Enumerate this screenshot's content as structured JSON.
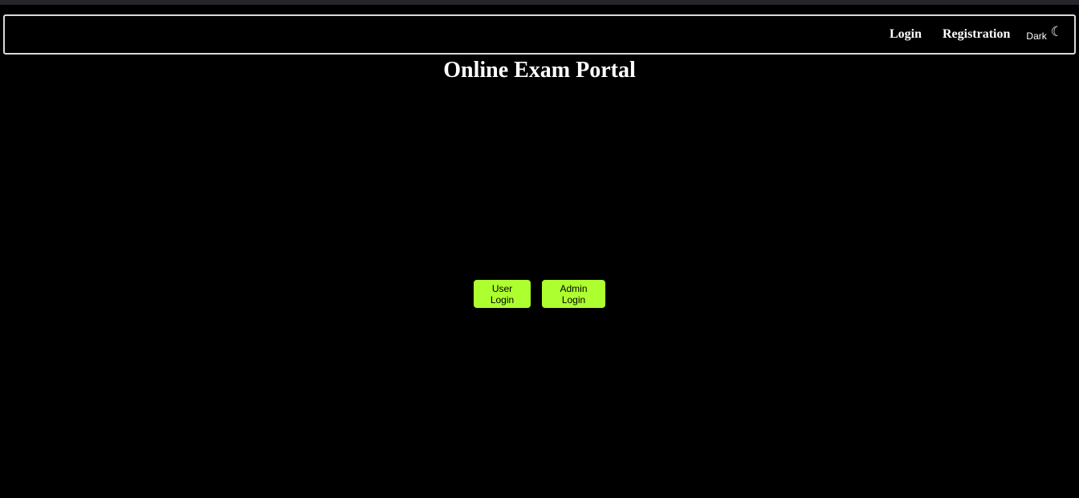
{
  "nav": {
    "login_label": "Login",
    "registration_label": "Registration",
    "theme_label": "Dark",
    "theme_icon": "moon-icon"
  },
  "page": {
    "title": "Online Exam Portal"
  },
  "actions": {
    "user_login_label": "User Login",
    "admin_login_label": "Admin Login"
  },
  "colors": {
    "background": "#000000",
    "accent_button": "#adff2f",
    "text": "#ffffff"
  }
}
